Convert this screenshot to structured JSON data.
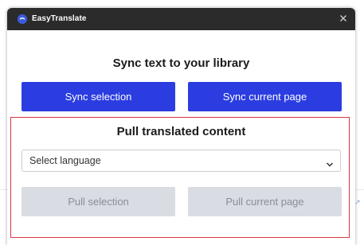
{
  "app": {
    "title": "EasyTranslate"
  },
  "sync": {
    "heading": "Sync text to your library",
    "selection_label": "Sync selection",
    "page_label": "Sync current page"
  },
  "pull": {
    "heading": "Pull translated content",
    "language_select": {
      "selected": "Select language"
    },
    "selection_label": "Pull selection",
    "page_label": "Pull current page"
  },
  "icons": {
    "logo": "easytranslate-logo-icon",
    "close": "close-icon",
    "chevron": "chevron-down-icon"
  },
  "colors": {
    "titlebar": "#2b2b2b",
    "primary_button": "#2b3de0",
    "disabled_button": "#dadce3",
    "highlight_border": "#d9363e",
    "logo": "#3b5bdb"
  }
}
